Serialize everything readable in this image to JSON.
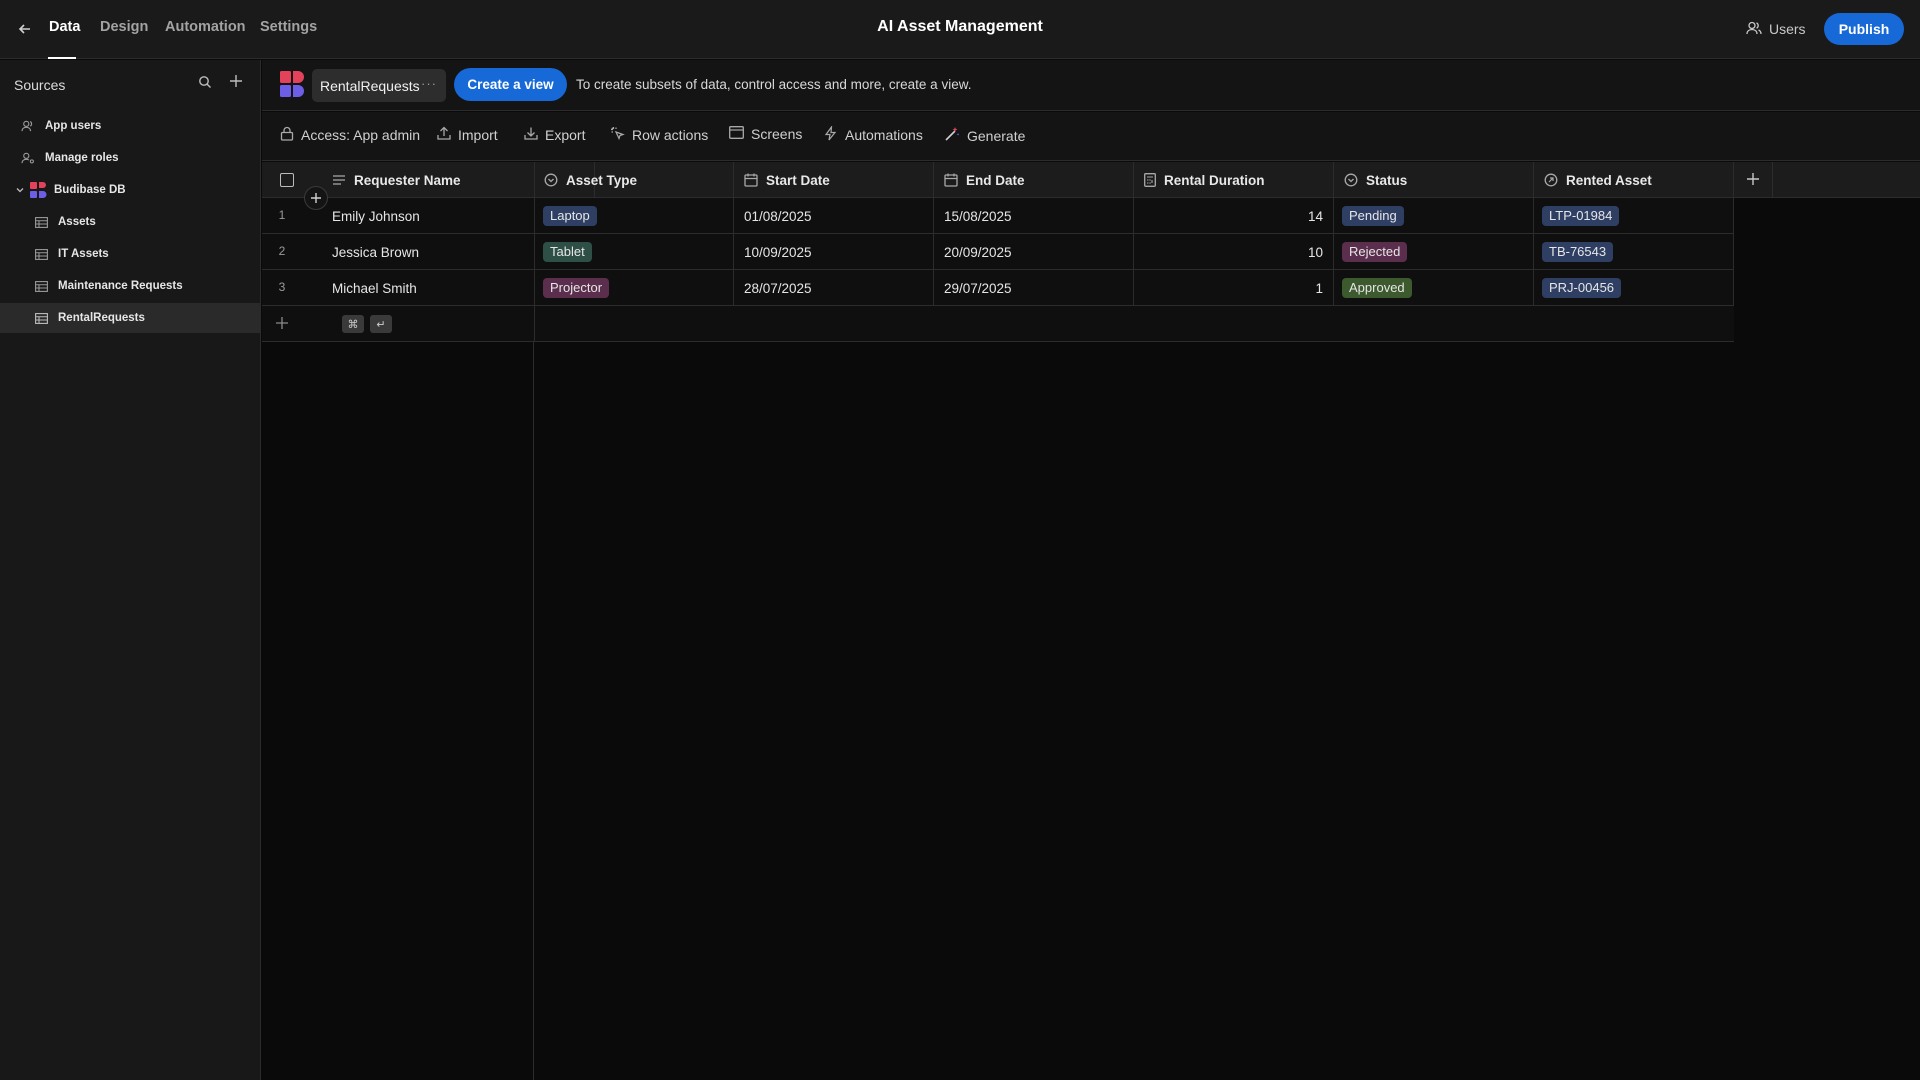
{
  "topbar": {
    "tabs": [
      {
        "label": "Data",
        "active": true
      },
      {
        "label": "Design",
        "active": false
      },
      {
        "label": "Automation",
        "active": false
      },
      {
        "label": "Settings",
        "active": false
      }
    ],
    "app_title": "AI Asset Management",
    "users_label": "Users",
    "publish_label": "Publish"
  },
  "sidebar": {
    "title": "Sources",
    "items": [
      {
        "label": "App users",
        "icon": "users-icon"
      },
      {
        "label": "Manage roles",
        "icon": "user-roles-icon"
      },
      {
        "label": "Budibase DB",
        "icon": "budibase-db-icon",
        "expanded": true
      },
      {
        "label": "Assets",
        "icon": "table-icon"
      },
      {
        "label": "IT Assets",
        "icon": "table-icon"
      },
      {
        "label": "Maintenance Requests",
        "icon": "table-icon"
      },
      {
        "label": "RentalRequests",
        "icon": "table-icon",
        "selected": true
      }
    ]
  },
  "subhead": {
    "table_name": "RentalRequests",
    "more_label": "···",
    "create_view_label": "Create a view",
    "hint": "To create subsets of data, control access and more, create a view."
  },
  "toolbar": {
    "access": "Access: App admin",
    "import": "Import",
    "export": "Export",
    "row_actions": "Row actions",
    "screens": "Screens",
    "automations": "Automations",
    "generate": "Generate"
  },
  "grid": {
    "columns": [
      "Requester Name",
      "Asset Type",
      "Start Date",
      "End Date",
      "Rental Duration",
      "Status",
      "Rented Asset"
    ],
    "rows": [
      {
        "num": "1",
        "requester": "Emily Johnson",
        "asset_type": "Laptop",
        "start": "01/08/2025",
        "end": "15/08/2025",
        "duration": "14",
        "status": "Pending",
        "asset": "LTP-01984"
      },
      {
        "num": "2",
        "requester": "Jessica Brown",
        "asset_type": "Tablet",
        "start": "10/09/2025",
        "end": "20/09/2025",
        "duration": "10",
        "status": "Rejected",
        "asset": "TB-76543"
      },
      {
        "num": "3",
        "requester": "Michael Smith",
        "asset_type": "Projector",
        "start": "28/07/2025",
        "end": "29/07/2025",
        "duration": "1",
        "status": "Approved",
        "asset": "PRJ-00456"
      }
    ],
    "kbd_cmd": "⌘",
    "kbd_enter": "↵"
  },
  "colors": {
    "accent": "#1669d6",
    "laptop": "#2f3f63",
    "tablet": "#2d4f45",
    "projector": "#5a2e4c",
    "pending": "#2f3f63",
    "rejected": "#5a2e4c",
    "approved": "#3d5a2e",
    "asset_chip": "#2f3f63"
  }
}
